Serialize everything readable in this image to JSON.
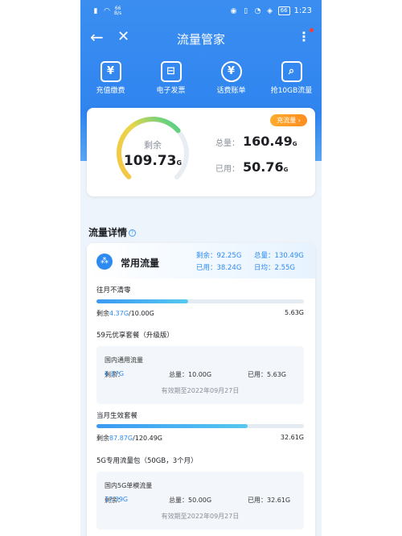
{
  "status_bar": {
    "net_speed": "66",
    "net_speed_unit": "B/s",
    "battery": "66",
    "time": "1:23"
  },
  "nav": {
    "title": "流量管家"
  },
  "quick_actions": [
    {
      "label": "充值缴费",
      "icon": "yuan-card-icon"
    },
    {
      "label": "电子发票",
      "icon": "invoice-icon"
    },
    {
      "label": "话费账单",
      "icon": "bill-search-icon"
    },
    {
      "label": "抢10GB流量",
      "icon": "doc-search-icon"
    }
  ],
  "summary": {
    "remaining_label": "剩余",
    "remaining_value": "109.73",
    "remaining_unit": "G",
    "recharge_label": "充流量 ›",
    "total_label": "总量：",
    "total_value": "160.49",
    "total_unit": "G",
    "used_label": "已用：",
    "used_value": "50.76",
    "used_unit": "G",
    "remaining_fraction": 0.68
  },
  "details": {
    "section_title": "流量详情",
    "card_title": "常用流量",
    "card_stats": {
      "remaining": "剩余：92.25G",
      "total": "总量：130.49G",
      "used": "已用：38.24G",
      "daily": "日均：2.55G"
    },
    "packages": [
      {
        "title": "往月不清零",
        "fill": 0.44,
        "remaining_prefix": "剩余",
        "remaining": "4.37G",
        "total": "/10.00G",
        "used": "5.63G"
      },
      {
        "title": "当月生效套餐",
        "fill": 0.73,
        "remaining_prefix": "剩余",
        "remaining": "87.87G",
        "total": "/120.49G",
        "used": "32.61G"
      }
    ],
    "plan1": {
      "title": "59元优享套餐（升级版）",
      "box_name": "国内通用流量",
      "remaining_label": "剩余：",
      "remaining": "4.37G",
      "total": "总量：10.00G",
      "used": "已用：5.63G",
      "expire": "有效期至2022年09月27日"
    },
    "plan2": {
      "title": "5G专用流量包（50GB，3个月）",
      "box_name": "国内5G单模流量",
      "remaining_label": "剩余：",
      "remaining": "17.39G",
      "total": "总量：50.00G",
      "used": "已用：32.61G",
      "expire": "有效期至2022年09月27日"
    }
  },
  "colors": {
    "primary": "#2f84ef",
    "accent_orange": "#ff8d1f",
    "gauge_green": "#3ecf8e",
    "gauge_yellow": "#f5c542"
  }
}
